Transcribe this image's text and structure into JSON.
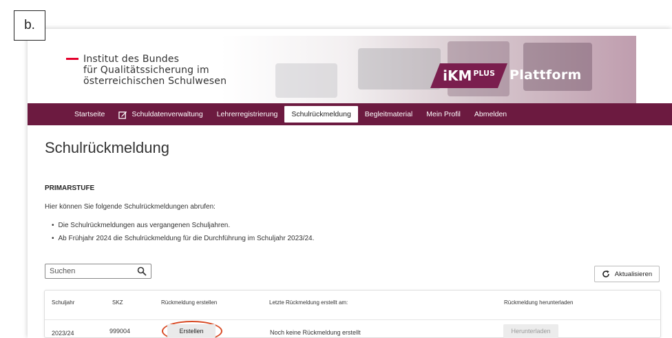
{
  "panel_label": "b.",
  "header": {
    "logo_lines": [
      "Institut des Bundes",
      "für Qualitätssicherung im",
      "österreichischen Schulwesen"
    ],
    "brand_main": "iKM",
    "brand_sup": "PLUS",
    "brand_plattform": "Plattform",
    "brand_color": "#7a1e4e"
  },
  "nav": {
    "color": "#6c1a40",
    "items": [
      {
        "label": "Startseite"
      },
      {
        "label": "Schuldatenverwaltung",
        "icon": "edit-icon"
      },
      {
        "label": "Lehrerregistrierung"
      },
      {
        "label": "Schulrückmeldung",
        "active": true
      },
      {
        "label": "Begleitmaterial"
      },
      {
        "label": "Mein Profil"
      },
      {
        "label": "Abmelden"
      }
    ]
  },
  "main": {
    "title": "Schulrückmeldung",
    "section_title": "PRIMARSTUFE",
    "intro": "Hier können Sie folgende Schulrückmeldungen abrufen:",
    "bullets": [
      "Die Schulrückmeldungen aus vergangenen Schuljahren.",
      "Ab Frühjahr 2024 die Schulrückmeldung für die Durchführung im Schuljahr 2023/24."
    ],
    "search": {
      "placeholder": "Suchen",
      "icon": "search-icon"
    },
    "refresh": {
      "label": "Aktualisieren",
      "icon": "refresh-icon"
    }
  },
  "table": {
    "columns": [
      "Schuljahr",
      "SKZ",
      "Rückmeldung erstellen",
      "Letzte Rückmeldung erstellt am:",
      "Rückmeldung herunterladen"
    ],
    "rows": [
      {
        "schuljahr": "2023/24",
        "skz": "999004",
        "create_label": "Erstellen",
        "last_created": "Noch keine Rückmeldung erstellt",
        "download_label": "Herunterladen"
      }
    ],
    "highlight_color": "#d84a24"
  }
}
